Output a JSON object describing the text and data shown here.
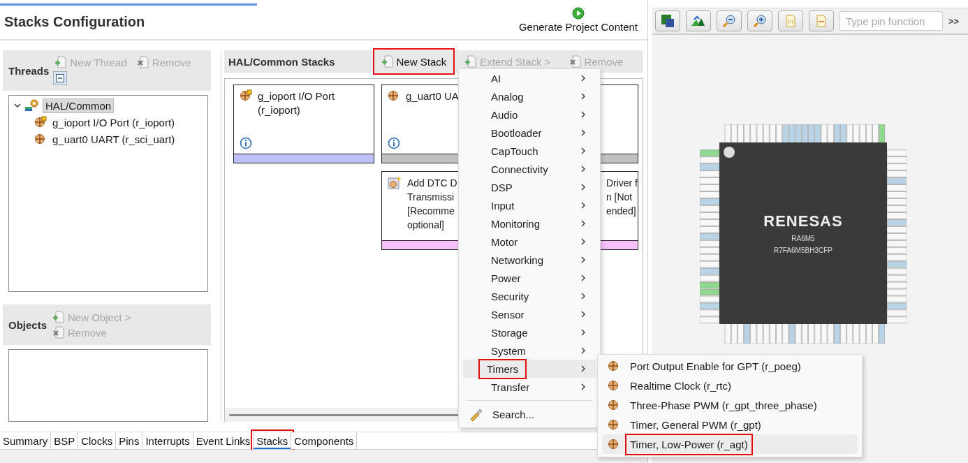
{
  "editor": {
    "title": "Stacks Configuration",
    "generate_button": "Generate Project Content"
  },
  "threads": {
    "title": "Threads",
    "actions": [
      {
        "label": "New Thread",
        "disabled": true
      },
      {
        "label": "Remove",
        "disabled": true
      }
    ],
    "tree": [
      {
        "label": "HAL/Common",
        "selected": true,
        "expanded": true,
        "children": [
          {
            "label": "g_ioport I/O Port (r_ioport)",
            "selected": false
          },
          {
            "label": "g_uart0 UART (r_sci_uart)",
            "selected": false
          }
        ]
      }
    ]
  },
  "objects": {
    "title": "Objects",
    "actions": [
      {
        "label": "New Object >",
        "disabled": true
      },
      {
        "label": "Remove",
        "disabled": true
      }
    ]
  },
  "stacks": {
    "title": "HAL/Common Stacks",
    "actions": [
      {
        "label": "New Stack",
        "disabled": false,
        "annotated": true
      },
      {
        "label": "Extend Stack >",
        "disabled": true,
        "annotated": false
      },
      {
        "label": "Remove",
        "disabled": true,
        "annotated": false
      }
    ],
    "cards": [
      {
        "kind": "module",
        "title": "g_ioport I/O Port (r_ioport)",
        "color": "#c0c0f8"
      },
      {
        "kind": "module",
        "title": "g_uart0 UA",
        "color": "#c0c0c0"
      },
      {
        "kind": "dependency",
        "left_lines": [
          "Add DTC D",
          "Transmissi",
          "[Recomme",
          "optional]"
        ],
        "right_lines": [
          "Driver f",
          "n [Not",
          "ended]"
        ],
        "color": "#f8c0f8"
      }
    ]
  },
  "menu": {
    "items": [
      {
        "kind": "category",
        "label": "AI",
        "selected": false,
        "annotated": false
      },
      {
        "kind": "category",
        "label": "Analog",
        "selected": false,
        "annotated": false
      },
      {
        "kind": "category",
        "label": "Audio",
        "selected": false,
        "annotated": false
      },
      {
        "kind": "category",
        "label": "Bootloader",
        "selected": false,
        "annotated": false
      },
      {
        "kind": "category",
        "label": "CapTouch",
        "selected": false,
        "annotated": false
      },
      {
        "kind": "category",
        "label": "Connectivity",
        "selected": false,
        "annotated": false
      },
      {
        "kind": "category",
        "label": "DSP",
        "selected": false,
        "annotated": false
      },
      {
        "kind": "category",
        "label": "Input",
        "selected": false,
        "annotated": false
      },
      {
        "kind": "category",
        "label": "Monitoring",
        "selected": false,
        "annotated": false
      },
      {
        "kind": "category",
        "label": "Motor",
        "selected": false,
        "annotated": false
      },
      {
        "kind": "category",
        "label": "Networking",
        "selected": false,
        "annotated": false
      },
      {
        "kind": "category",
        "label": "Power",
        "selected": false,
        "annotated": false
      },
      {
        "kind": "category",
        "label": "Security",
        "selected": false,
        "annotated": false
      },
      {
        "kind": "category",
        "label": "Sensor",
        "selected": false,
        "annotated": false
      },
      {
        "kind": "category",
        "label": "Storage",
        "selected": false,
        "annotated": false
      },
      {
        "kind": "category",
        "label": "System",
        "selected": false,
        "annotated": false
      },
      {
        "kind": "category",
        "label": "Timers",
        "selected": true,
        "annotated": true
      },
      {
        "kind": "category",
        "label": "Transfer",
        "selected": false,
        "annotated": false
      },
      {
        "kind": "search",
        "label": "Search..."
      }
    ]
  },
  "submenu": {
    "items": [
      {
        "label": "Port Output Enable for GPT (r_poeg)",
        "selected": false,
        "annotated": false
      },
      {
        "label": "Realtime Clock (r_rtc)",
        "selected": false,
        "annotated": false
      },
      {
        "label": "Three-Phase PWM (r_gpt_three_phase)",
        "selected": false,
        "annotated": false
      },
      {
        "label": "Timer, General PWM (r_gpt)",
        "selected": false,
        "annotated": false
      },
      {
        "label": "Timer, Low-Power (r_agt)",
        "selected": true,
        "annotated": true
      }
    ]
  },
  "bottom_tabs": [
    {
      "label": "Summary",
      "selected": false,
      "annotated": false
    },
    {
      "label": "BSP",
      "selected": false,
      "annotated": false
    },
    {
      "label": "Clocks",
      "selected": false,
      "annotated": false
    },
    {
      "label": "Pins",
      "selected": false,
      "annotated": false
    },
    {
      "label": "Interrupts",
      "selected": false,
      "annotated": false
    },
    {
      "label": "Event Links",
      "selected": false,
      "annotated": false
    },
    {
      "label": "Stacks",
      "selected": true,
      "annotated": true
    },
    {
      "label": "Components",
      "selected": false,
      "annotated": false
    }
  ],
  "pin_view": {
    "search_placeholder": "Type pin function",
    "overflow": ">>",
    "chip": {
      "brand": "RENESAS",
      "model": "RA6M5",
      "part": "R7FA6M5BH3CFP"
    }
  }
}
